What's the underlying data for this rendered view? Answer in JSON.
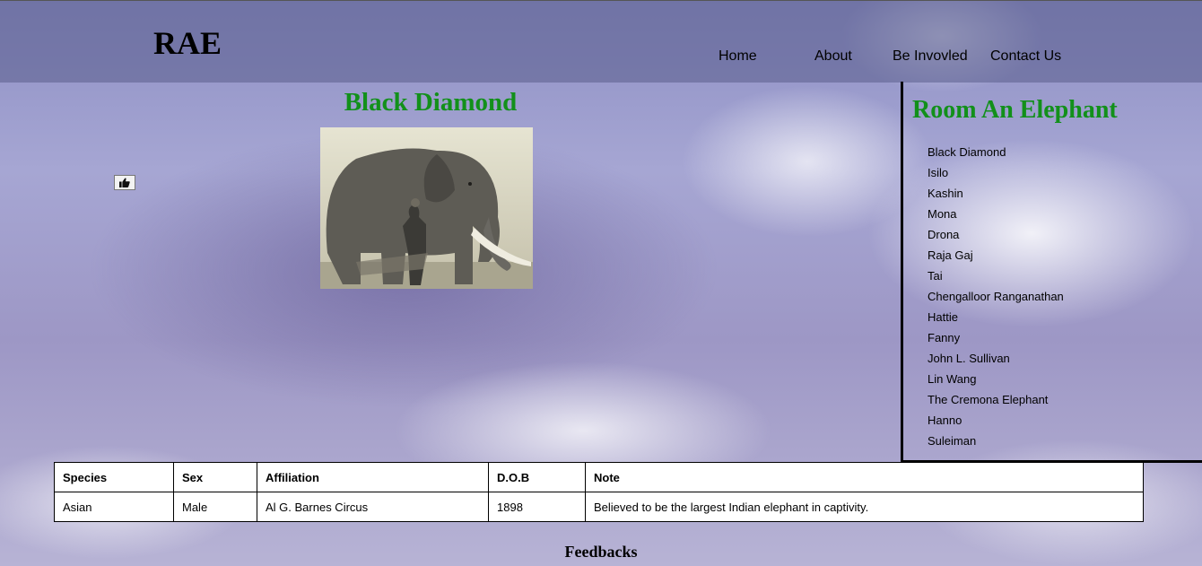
{
  "header": {
    "logo": "RAE",
    "nav": [
      "Home",
      "About",
      "Be Invovled",
      "Contact Us"
    ]
  },
  "main": {
    "like_icon": "thumbs-up-icon",
    "title": "Black Diamond",
    "photo": "elephant-with-handler-photo"
  },
  "sidebar": {
    "heading": "Room An Elephant",
    "items": [
      "Black Diamond",
      "Isilo",
      "Kashin",
      "Mona",
      "Drona",
      "Raja Gaj",
      "Tai",
      "Chengalloor Ranganathan",
      "Hattie",
      "Fanny",
      "John L. Sullivan",
      "Lin Wang",
      "The Cremona Elephant",
      "Hanno",
      "Suleiman"
    ]
  },
  "info_table": {
    "headers": [
      "Species",
      "Sex",
      "Affiliation",
      "D.O.B",
      "Note"
    ],
    "rows": [
      [
        "Asian",
        "Male",
        "Al G. Barnes Circus",
        "1898",
        "Believed to be the largest Indian elephant in captivity."
      ]
    ]
  },
  "feedback": {
    "heading": "Feedbacks"
  },
  "colors": {
    "title_green": "#12901a",
    "header_overlay": "#5a5c8c"
  }
}
